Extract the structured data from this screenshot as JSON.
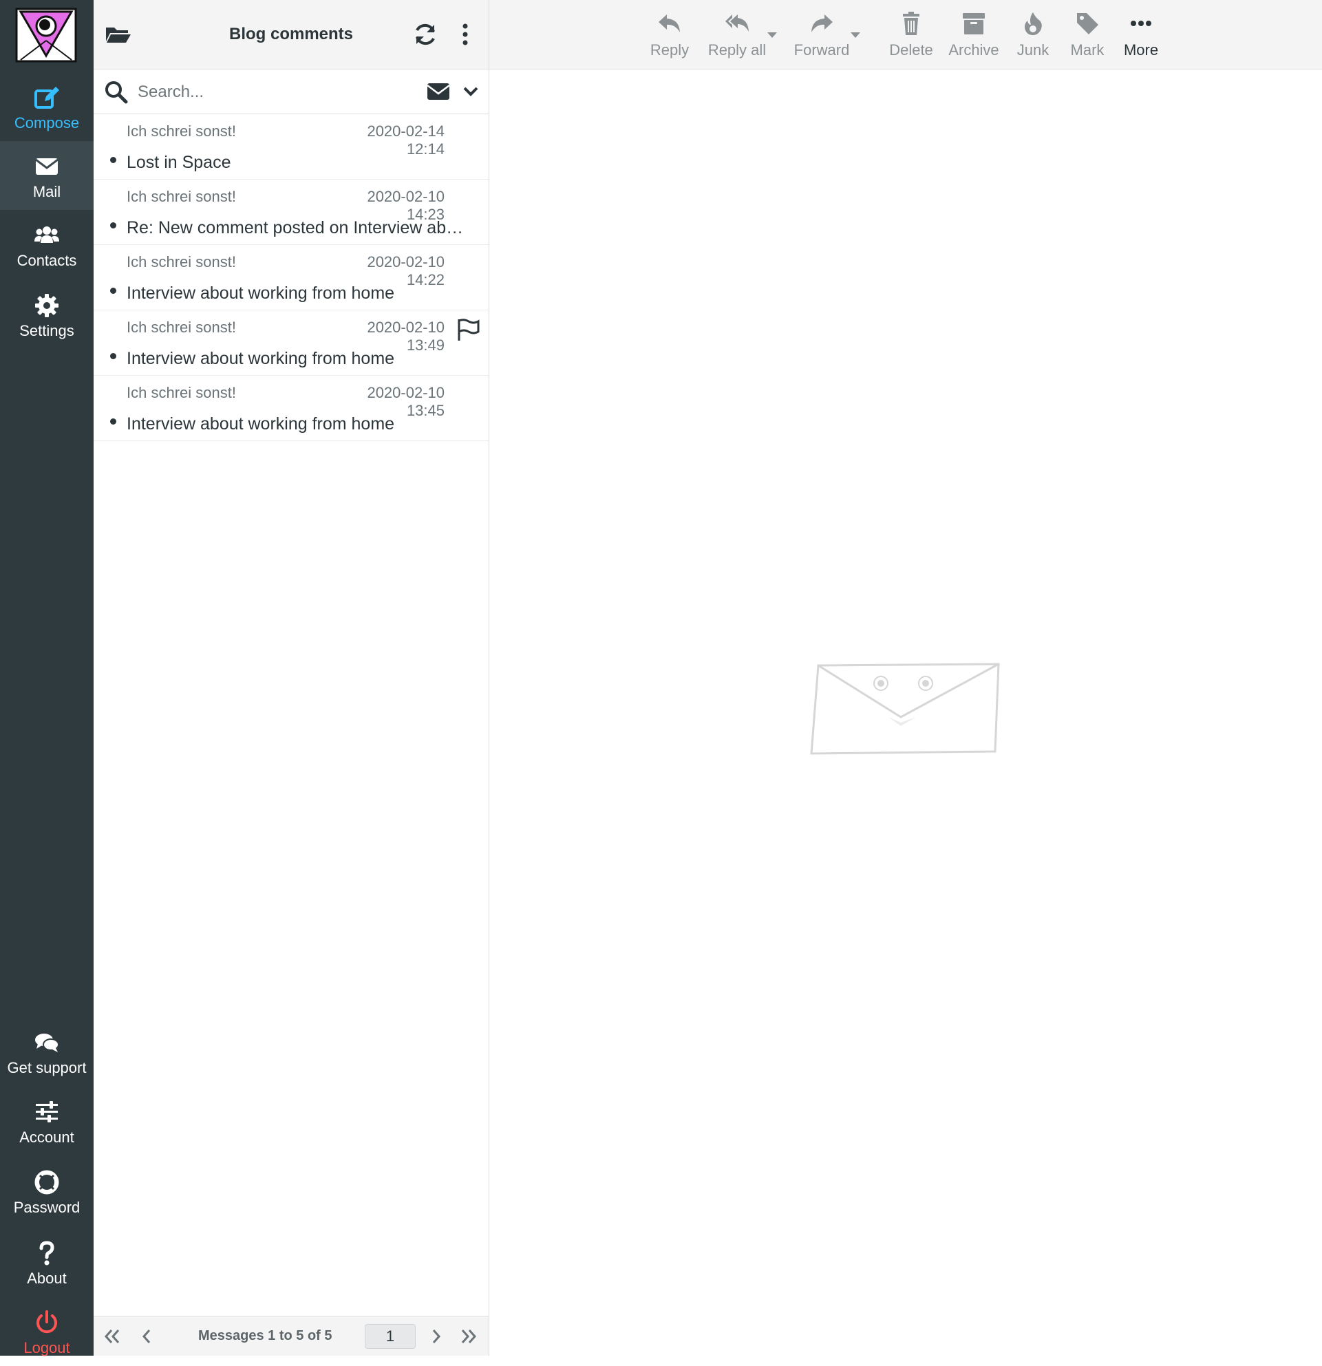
{
  "nav": {
    "top": [
      {
        "key": "compose",
        "label": "Compose",
        "icon": "compose-icon"
      },
      {
        "key": "mail",
        "label": "Mail",
        "icon": "envelope-icon"
      },
      {
        "key": "contacts",
        "label": "Contacts",
        "icon": "users-icon"
      },
      {
        "key": "settings",
        "label": "Settings",
        "icon": "gear-icon"
      }
    ],
    "bottom": [
      {
        "key": "support",
        "label": "Get support",
        "icon": "chat-bubbles-icon"
      },
      {
        "key": "account",
        "label": "Account",
        "icon": "sliders-icon"
      },
      {
        "key": "password",
        "label": "Password",
        "icon": "lifebuoy-icon"
      },
      {
        "key": "about",
        "label": "About",
        "icon": "question-icon"
      },
      {
        "key": "logout",
        "label": "Logout",
        "icon": "power-icon"
      }
    ],
    "active": "mail"
  },
  "list": {
    "title": "Blog comments",
    "search_placeholder": "Search...",
    "messages": [
      {
        "from": "Ich schrei sonst!",
        "date": "2020-02-14 12:14",
        "subject": "Lost in Space",
        "unread": true,
        "flagged": false
      },
      {
        "from": "Ich schrei sonst!",
        "date": "2020-02-10 14:23",
        "subject": "Re: New comment posted on Interview about working from home",
        "unread": true,
        "flagged": false
      },
      {
        "from": "Ich schrei sonst!",
        "date": "2020-02-10 14:22",
        "subject": "Interview about working from home",
        "unread": true,
        "flagged": false
      },
      {
        "from": "Ich schrei sonst!",
        "date": "2020-02-10 13:49",
        "subject": "Interview about working from home",
        "unread": true,
        "flagged": true
      },
      {
        "from": "Ich schrei sonst!",
        "date": "2020-02-10 13:45",
        "subject": "Interview about working from home",
        "unread": true,
        "flagged": false
      }
    ],
    "pager": {
      "count_text": "Messages 1 to 5 of 5",
      "page": "1"
    }
  },
  "toolbar": {
    "reply": "Reply",
    "reply_all": "Reply all",
    "forward": "Forward",
    "delete": "Delete",
    "archive": "Archive",
    "junk": "Junk",
    "mark": "Mark",
    "more": "More"
  },
  "colors": {
    "nav_bg": "#2f3a3f",
    "accent": "#37beff",
    "logout": "#ff5552",
    "text": "#2c363a",
    "muted": "#8c9194"
  }
}
